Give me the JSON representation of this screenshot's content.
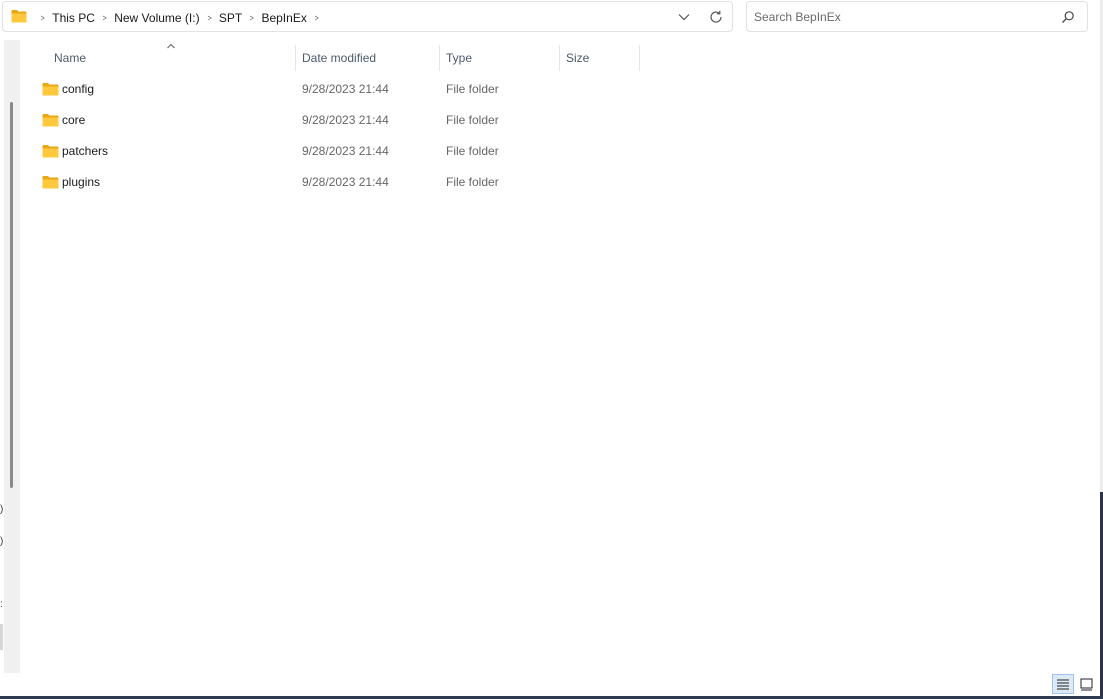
{
  "address_bar": {
    "breadcrumbs": [
      "This PC",
      "New Volume (I:)",
      "SPT",
      "BepInEx"
    ]
  },
  "search": {
    "placeholder": "Search BepInEx",
    "value": ""
  },
  "file_list": {
    "columns": [
      "Name",
      "Date modified",
      "Type",
      "Size"
    ],
    "sorted_by": "Name",
    "rows": [
      {
        "name": "config",
        "date_modified": "9/28/2023 21:44",
        "type": "File folder",
        "size": ""
      },
      {
        "name": "core",
        "date_modified": "9/28/2023 21:44",
        "type": "File folder",
        "size": ""
      },
      {
        "name": "patchers",
        "date_modified": "9/28/2023 21:44",
        "type": "File folder",
        "size": ""
      },
      {
        "name": "plugins",
        "date_modified": "9/28/2023 21:44",
        "type": "File folder",
        "size": ""
      }
    ]
  },
  "view_mode": {
    "active": "details",
    "options": [
      "details",
      "large-icons"
    ]
  },
  "icons": {
    "folder": "folder-icon",
    "chevron_down": "chevron-down-icon",
    "refresh": "refresh-icon",
    "search": "search-icon",
    "sort_ascending": "sort-ascending-icon",
    "view_details": "details-view-icon",
    "view_large_icons": "large-icons-view-icon"
  },
  "colors": {
    "folder": "#ffc83d",
    "column_header_text": "#4c5a6b",
    "active_view_bg": "#dce9f7"
  }
}
